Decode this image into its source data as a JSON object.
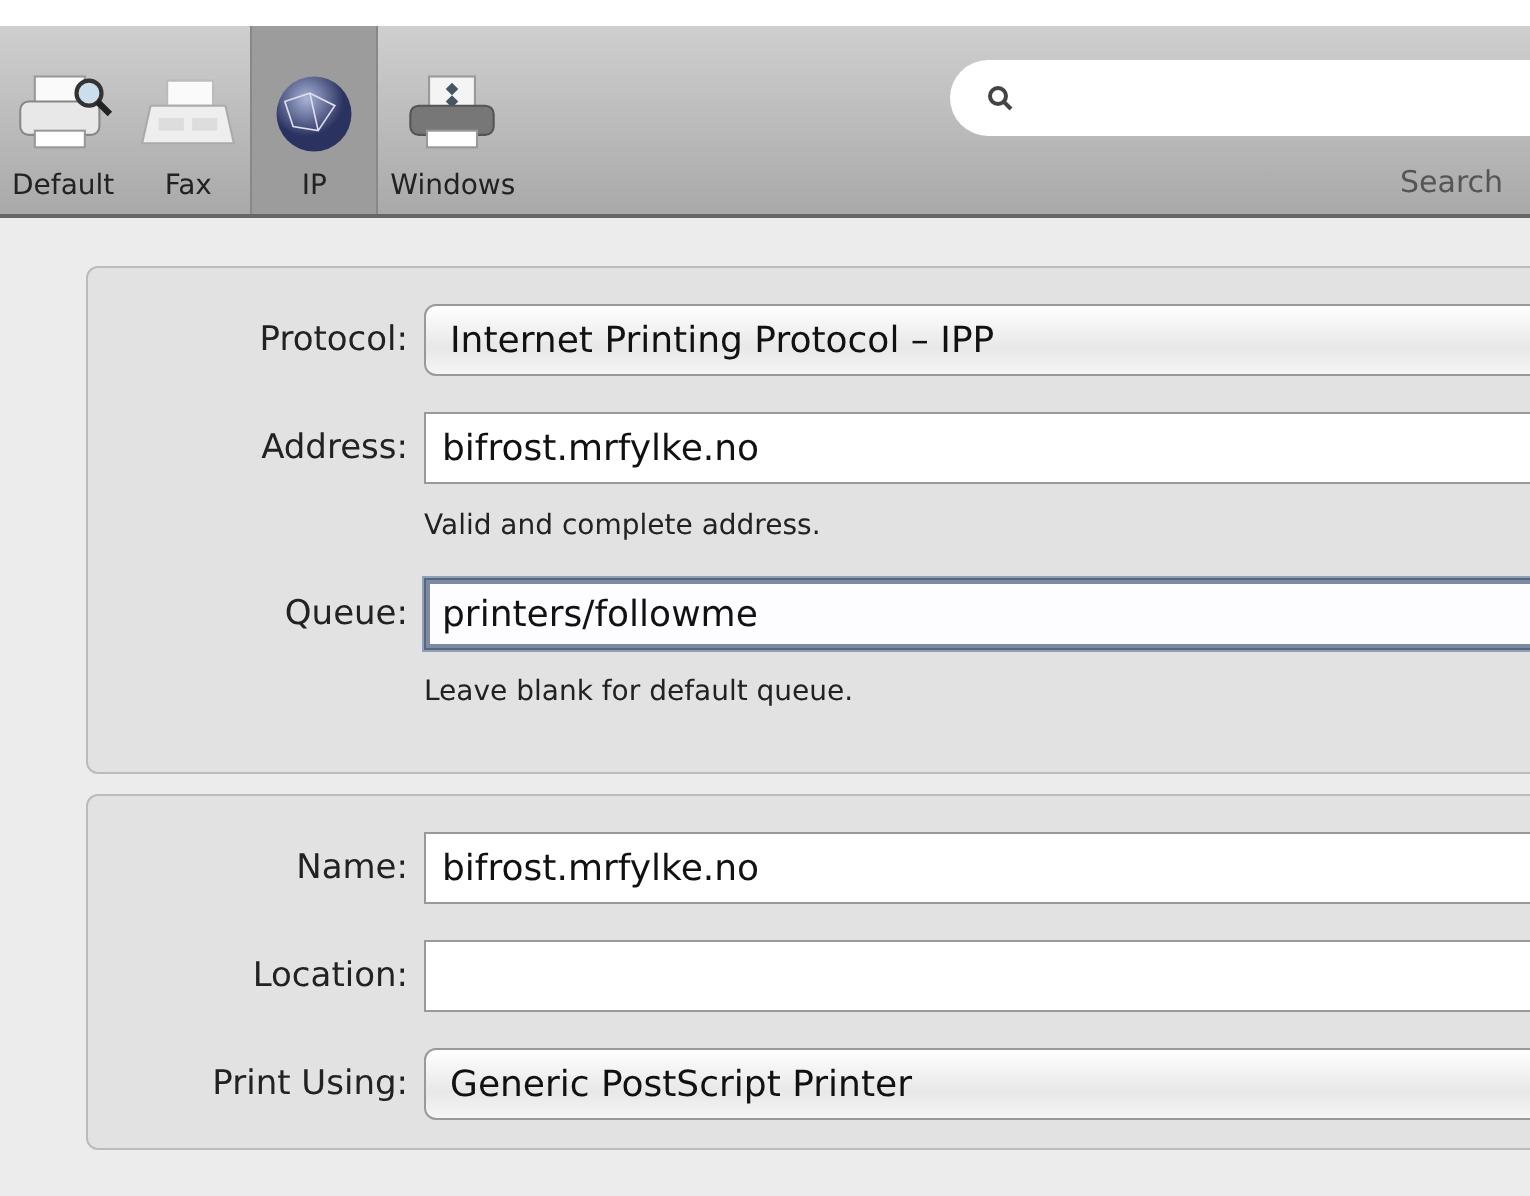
{
  "toolbar": {
    "items": [
      {
        "label": "Default",
        "kind": "default",
        "selected": false
      },
      {
        "label": "Fax",
        "kind": "fax",
        "selected": false
      },
      {
        "label": "IP",
        "kind": "network",
        "selected": true
      },
      {
        "label": "Windows",
        "kind": "windows",
        "selected": false
      }
    ],
    "search": {
      "label": "Search"
    }
  },
  "sections": [
    {
      "rows": [
        {
          "label": "Protocol:",
          "kind": "popup",
          "value": "Internet Printing Protocol – IPP",
          "focused": false
        },
        {
          "label": "Address:",
          "kind": "text",
          "value": "bifrost.mrfylke.no",
          "hint": "Valid and complete address.",
          "focused": false
        },
        {
          "label": "Queue:",
          "kind": "text",
          "value": "printers/followme",
          "hint": "Leave blank for default queue.",
          "focused": true
        }
      ]
    },
    {
      "rows": [
        {
          "label": "Name:",
          "kind": "text",
          "value": "bifrost.mrfylke.no",
          "focused": false
        },
        {
          "label": "Location:",
          "kind": "text",
          "focused": false
        },
        {
          "label": "Print Using:",
          "kind": "popup",
          "value": "Generic PostScript Printer",
          "focused": false
        }
      ]
    }
  ]
}
